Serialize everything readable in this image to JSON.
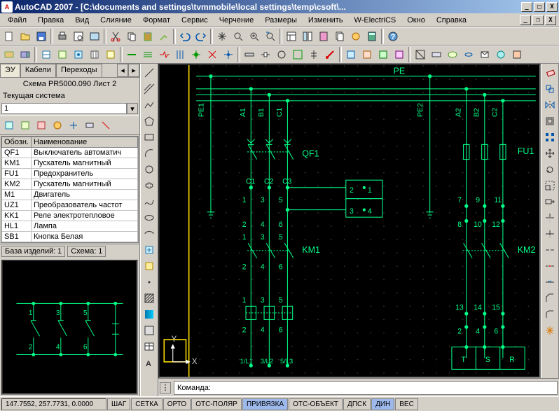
{
  "window": {
    "title": "AutoCAD 2007 - [C:\\documents and settings\\tvmmobile\\local settings\\temp\\csoft\\...",
    "min": "_",
    "max": "□",
    "close": "X"
  },
  "menu": [
    "Файл",
    "Правка",
    "Вид",
    "Слияние",
    "Формат",
    "Сервис",
    "Черчение",
    "Размеры",
    "Изменить",
    "W-ElectriCS",
    "Окно",
    "Справка"
  ],
  "sidebar": {
    "tabs": [
      "ЭУ",
      "Кабели",
      "Переходы"
    ],
    "scheme_title": "Схема PR5000.090 Лист 2",
    "system_label": "Текущая система",
    "system_value": "1",
    "cols": [
      "Обозн.",
      "Наименование"
    ],
    "rows": [
      {
        "code": "QF1",
        "name": "Выключатель автоматич"
      },
      {
        "code": "KM1",
        "name": "Пускатель магнитный"
      },
      {
        "code": "FU1",
        "name": "Предохранитель"
      },
      {
        "code": "KM2",
        "name": "Пускатель магнитный"
      },
      {
        "code": "M1",
        "name": "Двигатель"
      },
      {
        "code": "UZ1",
        "name": "Преобразователь частот"
      },
      {
        "code": "KK1",
        "name": "Реле электротепловое"
      },
      {
        "code": "HL1",
        "name": "Лампа"
      },
      {
        "code": "SB1",
        "name": "Кнопка Белая"
      }
    ],
    "footer_tabs": [
      {
        "l": "База изделий:",
        "v": "1"
      },
      {
        "l": "Схема:",
        "v": "1"
      }
    ]
  },
  "command": {
    "prompt": "Команда:"
  },
  "status": {
    "coord": "147.7552, 257.7731, 0.0000",
    "buttons": [
      "ШАГ",
      "СЕТКА",
      "ОРТО",
      "ОТС-ПОЛЯР",
      "ПРИВЯЗКА",
      "ОТС-ОБЪЕКТ",
      "ДПСК",
      "ДИН",
      "ВЕС"
    ]
  },
  "schematic": {
    "pe": "PE",
    "pe1": "PE1",
    "pe2": "PE2",
    "a1": "A1",
    "b1": "B1",
    "c1": "C1",
    "a2": "A2",
    "b2": "B2",
    "c2": "C2",
    "qf1": "QF1",
    "fu1": "FU1",
    "km1": "KM1",
    "km2": "KM2",
    "caps": [
      "C1",
      "C2",
      "C3"
    ],
    "box": [
      "1",
      "2",
      "3",
      "4"
    ],
    "n": [
      "1",
      "3",
      "5",
      "2",
      "4",
      "6",
      "1",
      "3",
      "5",
      "2",
      "4",
      "6",
      "1",
      "3",
      "5",
      "2",
      "4",
      "6"
    ],
    "refs": [
      "1/L1",
      "3/L2",
      "5/L3"
    ],
    "tsr": [
      "T",
      "S",
      "R"
    ],
    "b2n": [
      "7",
      "9",
      "11",
      "8",
      "10",
      "12",
      "13",
      "14",
      "15",
      "2",
      "4",
      "6"
    ]
  }
}
